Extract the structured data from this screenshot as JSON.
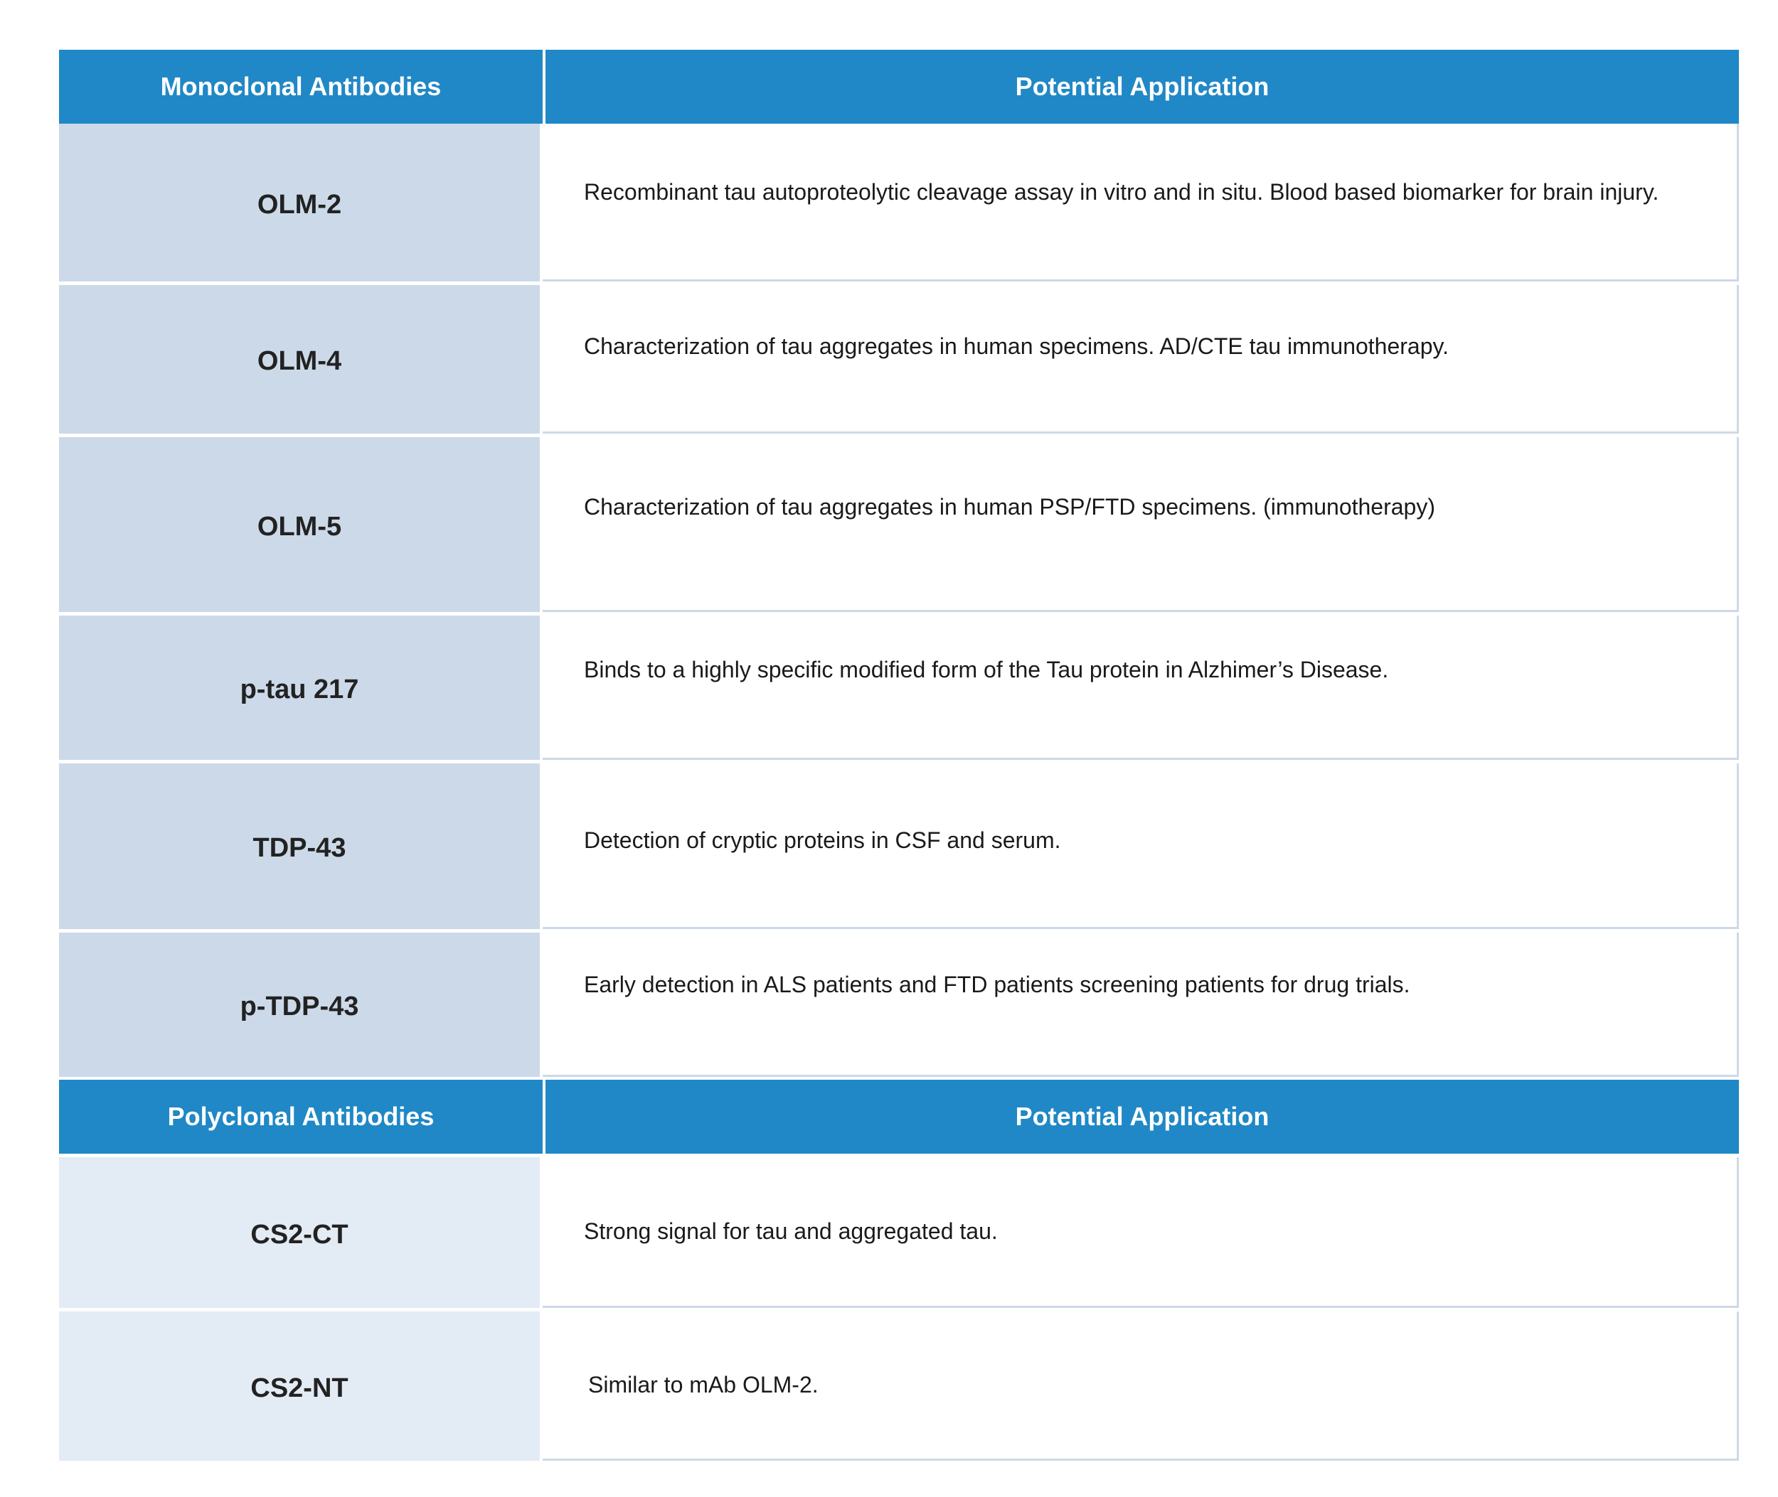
{
  "monoclonal_header": {
    "col1": "Monoclonal Antibodies",
    "col2": "Potential Application"
  },
  "monoclonal_rows": [
    {
      "name": "OLM-2",
      "application": "Recombinant tau autoproteolytic cleavage assay in vitro and in situ. Blood based biomarker for brain injury."
    },
    {
      "name": "OLM-4",
      "application": "Characterization of tau aggregates in human specimens. AD/CTE tau immunotherapy."
    },
    {
      "name": "OLM-5",
      "application": "Characterization of tau aggregates in human PSP/FTD specimens. (immunotherapy)"
    },
    {
      "name": "p-tau 217",
      "application": "Binds to a highly specific modified form of the Tau protein in Alzhimer’s Disease."
    },
    {
      "name": "TDP-43",
      "application": "Detection of cryptic proteins in CSF and serum."
    },
    {
      "name": "p-TDP-43",
      "application": "Early detection in ALS patients and FTD patients screening patients for drug trials."
    }
  ],
  "polyclonal_header": {
    "col1": "Polyclonal Antibodies",
    "col2": "Potential Application"
  },
  "polyclonal_rows": [
    {
      "name": "CS2-CT",
      "application": "Strong signal for tau and aggregated tau."
    },
    {
      "name": "CS2-NT",
      "application": "Similar to mAb OLM-2."
    }
  ],
  "colors": {
    "header_bg": "#2088c6",
    "monoclonal_name_bg": "#ccd9e9",
    "polyclonal_name_bg": "#e3ebf4"
  }
}
